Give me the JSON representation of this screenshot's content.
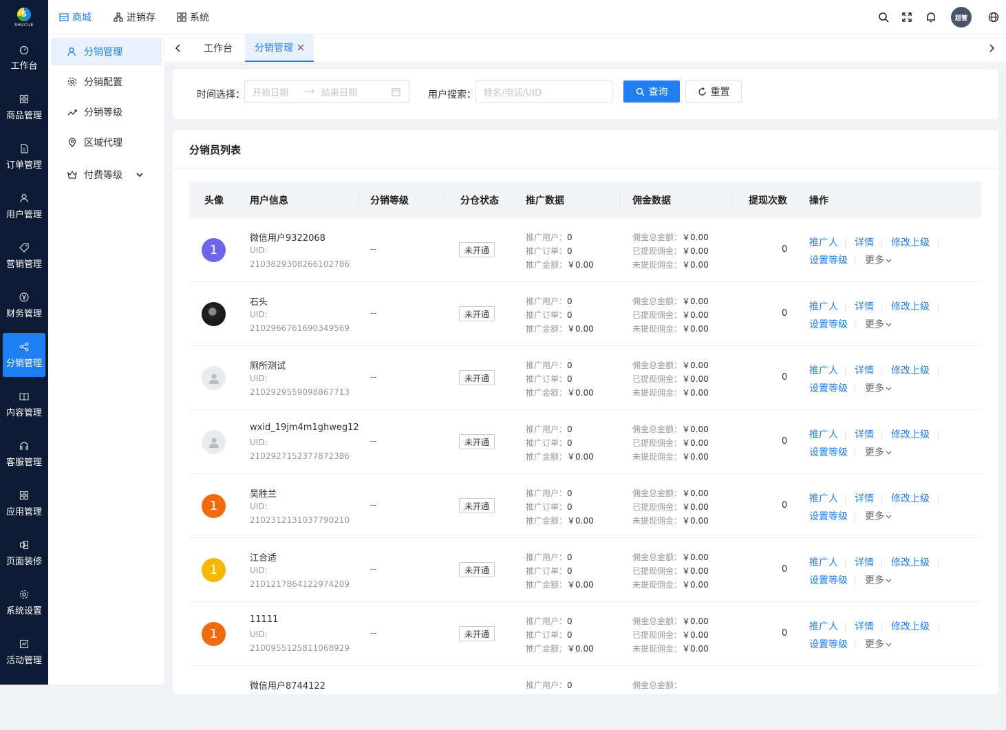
{
  "logo": {
    "text": "SHUCUE"
  },
  "sidebar": {
    "items": [
      {
        "label": "工作台",
        "icon": "dashboard-icon"
      },
      {
        "label": "商品管理",
        "icon": "grid-icon"
      },
      {
        "label": "订单管理",
        "icon": "file-icon"
      },
      {
        "label": "用户管理",
        "icon": "user-icon"
      },
      {
        "label": "营销管理",
        "icon": "tag-icon"
      },
      {
        "label": "财务管理",
        "icon": "yuan-icon"
      },
      {
        "label": "分销管理",
        "icon": "share-icon",
        "active": true
      },
      {
        "label": "内容管理",
        "icon": "book-icon"
      },
      {
        "label": "客服管理",
        "icon": "headset-icon"
      },
      {
        "label": "应用管理",
        "icon": "apps-icon"
      },
      {
        "label": "页面装修",
        "icon": "layout-icon"
      },
      {
        "label": "系统设置",
        "icon": "gear-icon"
      },
      {
        "label": "活动管理",
        "icon": "activity-icon"
      }
    ]
  },
  "topnav": {
    "mall": "商城",
    "inventory": "进销存",
    "system": "系统"
  },
  "user": {
    "avatar_text": "超管"
  },
  "submenu": {
    "items": [
      {
        "label": "分销管理",
        "active": true
      },
      {
        "label": "分销配置"
      },
      {
        "label": "分销等级"
      },
      {
        "label": "区域代理"
      },
      {
        "label": "付费等级"
      }
    ]
  },
  "tabs": {
    "workbench": "工作台",
    "current": "分销管理"
  },
  "filter": {
    "time_label": "时间选择：",
    "start_placeholder": "开始日期",
    "end_placeholder": "结束日期",
    "search_label": "用户搜索：",
    "search_placeholder": "姓名/电话/UID",
    "query": "查询",
    "reset": "重置"
  },
  "list": {
    "title": "分销员列表",
    "columns": [
      "头像",
      "用户信息",
      "分销等级",
      "分仓状态",
      "推广数据",
      "佣金数据",
      "提现次数",
      "操作"
    ],
    "promo_labels": [
      "推广用户：",
      "推广订单：",
      "推广金额："
    ],
    "comm_labels": [
      "佣金总金额：",
      "已提现佣金：",
      "未提现佣金："
    ],
    "actions": {
      "promoter": "推广人",
      "detail": "详情",
      "edit_parent": "修改上级",
      "set_level": "设置等级",
      "more": "更多"
    },
    "rows": [
      {
        "avatar": "1",
        "avatar_color": "#7064e8",
        "name": "微信用户9322068",
        "uid_label": "UID:",
        "uid": "2103829308266102786",
        "level": "--",
        "status": "未开通",
        "promo": [
          "0",
          "0",
          "￥0.00"
        ],
        "comm": [
          "￥0.00",
          "￥0.00",
          "￥0.00"
        ],
        "withdraw": "0"
      },
      {
        "avatar": "",
        "avatar_color": "photo",
        "name": "石头",
        "uid_label": "UID:",
        "uid": "2102966761690349569",
        "level": "--",
        "status": "未开通",
        "promo": [
          "0",
          "0",
          "￥0.00"
        ],
        "comm": [
          "￥0.00",
          "￥0.00",
          "￥0.00"
        ],
        "withdraw": "0"
      },
      {
        "avatar": "",
        "avatar_color": "default",
        "name": "厕所测试",
        "uid_label": "UID:",
        "uid": "2102929559098867713",
        "level": "--",
        "status": "未开通",
        "promo": [
          "0",
          "0",
          "￥0.00"
        ],
        "comm": [
          "￥0.00",
          "￥0.00",
          "￥0.00"
        ],
        "withdraw": "0"
      },
      {
        "avatar": "",
        "avatar_color": "default",
        "name": "wxid_19jm4m1ghweg12",
        "uid_label": "UID:",
        "uid": "2102927152377872386",
        "level": "--",
        "status": "未开通",
        "promo": [
          "0",
          "0",
          "￥0.00"
        ],
        "comm": [
          "￥0.00",
          "￥0.00",
          "￥0.00"
        ],
        "withdraw": "0"
      },
      {
        "avatar": "1",
        "avatar_color": "#f06a0f",
        "name": "吴胜兰",
        "uid_label": "UID:",
        "uid": "2102312131037790210",
        "level": "--",
        "status": "未开通",
        "promo": [
          "0",
          "0",
          "￥0.00"
        ],
        "comm": [
          "￥0.00",
          "￥0.00",
          "￥0.00"
        ],
        "withdraw": "0"
      },
      {
        "avatar": "1",
        "avatar_color": "#f5b800",
        "name": "江合适",
        "uid_label": "UID:",
        "uid": "2101217864122974209",
        "level": "--",
        "status": "未开通",
        "promo": [
          "0",
          "0",
          "￥0.00"
        ],
        "comm": [
          "￥0.00",
          "￥0.00",
          "￥0.00"
        ],
        "withdraw": "0"
      },
      {
        "avatar": "1",
        "avatar_color": "#f06a0f",
        "name": "11111",
        "uid_label": "UID:",
        "uid": "2100955125811068929",
        "level": "--",
        "status": "未开通",
        "promo": [
          "0",
          "0",
          "￥0.00"
        ],
        "comm": [
          "￥0.00",
          "￥0.00",
          "￥0.00"
        ],
        "withdraw": "0"
      },
      {
        "avatar": "",
        "avatar_color": "none",
        "name": "微信用户8744122",
        "uid_label": "",
        "uid": "",
        "level": "",
        "status": "",
        "promo": [
          "0",
          "",
          ""
        ],
        "comm": [
          "",
          "",
          ""
        ],
        "withdraw": "",
        "partial": true
      }
    ]
  }
}
